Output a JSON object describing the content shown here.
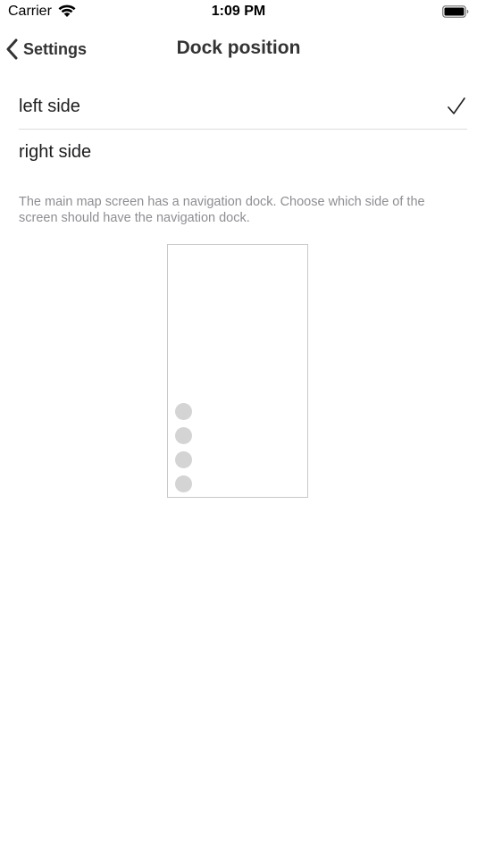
{
  "status_bar": {
    "carrier": "Carrier",
    "time": "1:09 PM",
    "icons": [
      "wifi-icon",
      "battery-icon"
    ]
  },
  "nav": {
    "back_label": "Settings",
    "title": "Dock position"
  },
  "options": [
    {
      "label": "left side",
      "selected": true
    },
    {
      "label": "right side",
      "selected": false
    }
  ],
  "description": "The main map screen has a navigation dock. Choose which side of the screen should have the navigation dock.",
  "preview": {
    "dock_side": "left",
    "dot_count": 4,
    "colors": {
      "dot": "#d4d4d4",
      "border": "#c8c8c8"
    }
  }
}
